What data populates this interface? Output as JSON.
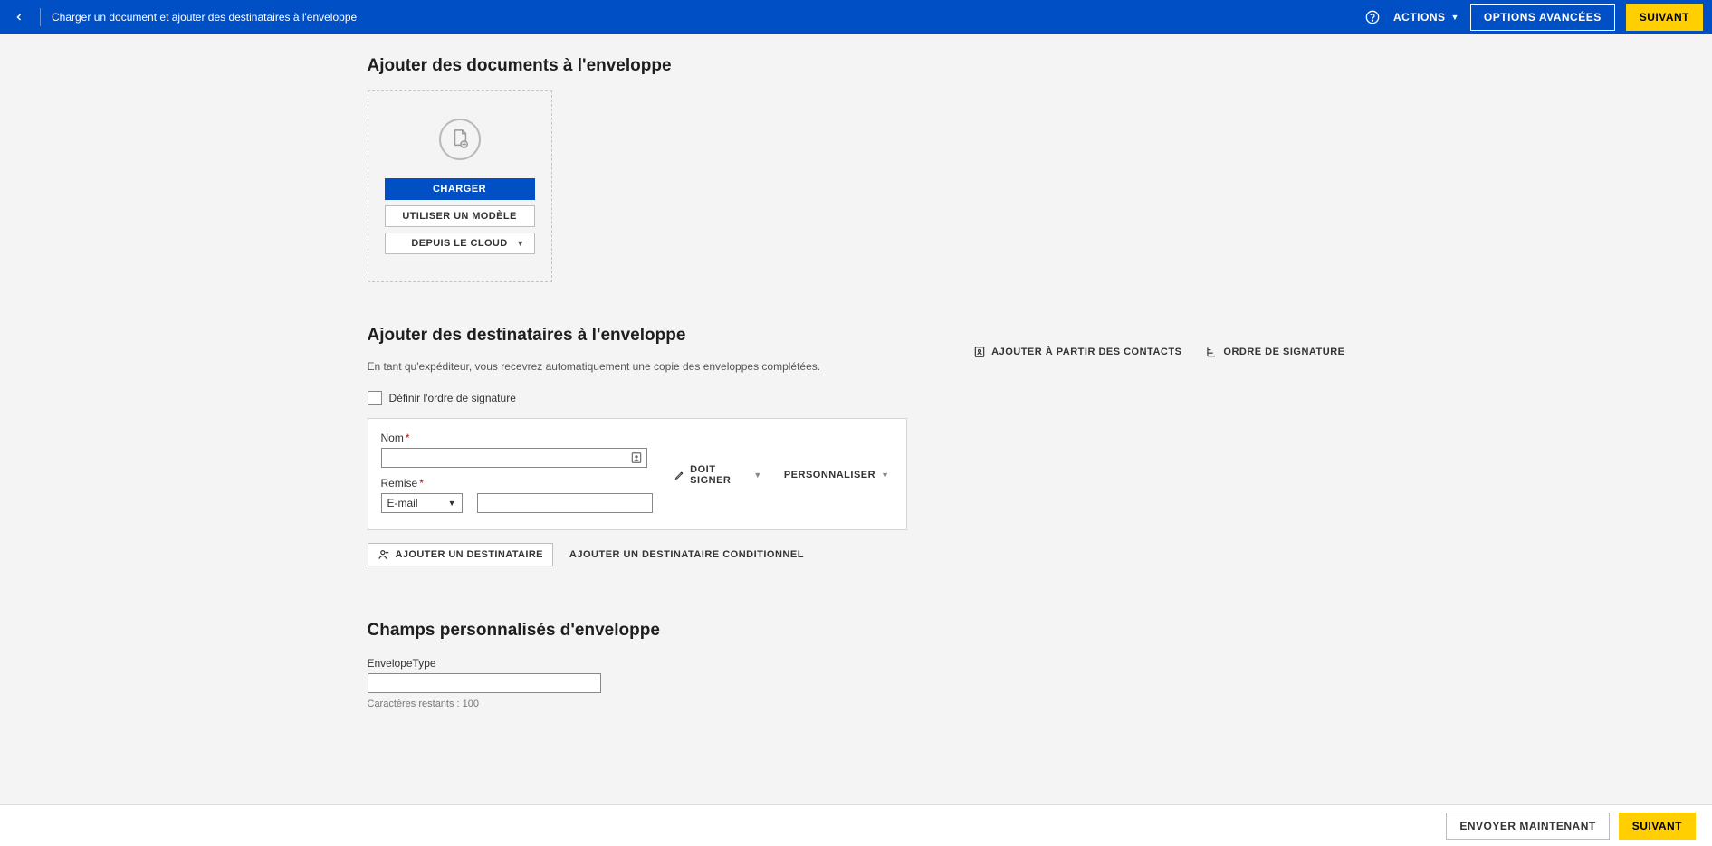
{
  "header": {
    "title": "Charger un document et ajouter des destinataires à l'enveloppe",
    "actions_label": "ACTIONS",
    "advanced_label": "OPTIONS AVANCÉES",
    "next_label": "SUIVANT"
  },
  "upload_section": {
    "heading": "Ajouter des documents à l'enveloppe",
    "load_btn": "CHARGER",
    "template_btn": "UTILISER UN MODÈLE",
    "cloud_btn": "DEPUIS LE CLOUD"
  },
  "recipients_section": {
    "heading": "Ajouter des destinataires à l'enveloppe",
    "subtext": "En tant qu'expéditeur, vous recevrez automatiquement une copie des enveloppes complétées.",
    "add_from_contacts": "AJOUTER À PARTIR DES CONTACTS",
    "sign_order_link": "ORDRE DE SIGNATURE",
    "define_order_checkbox": "Définir l'ordre de signature",
    "name_label": "Nom",
    "remise_label": "Remise",
    "remise_selected": "E-mail",
    "must_sign": "DOIT SIGNER",
    "customize": "PERSONNALISER",
    "add_recipient": "AJOUTER UN DESTINATAIRE",
    "add_conditional": "AJOUTER UN DESTINATAIRE CONDITIONNEL"
  },
  "custom_fields_section": {
    "heading": "Champs personnalisés d'enveloppe",
    "field1_label": "EnvelopeType",
    "field1_value": "",
    "counter": "Caractères restants : 100"
  },
  "footer": {
    "send_now": "ENVOYER MAINTENANT",
    "next": "SUIVANT"
  }
}
